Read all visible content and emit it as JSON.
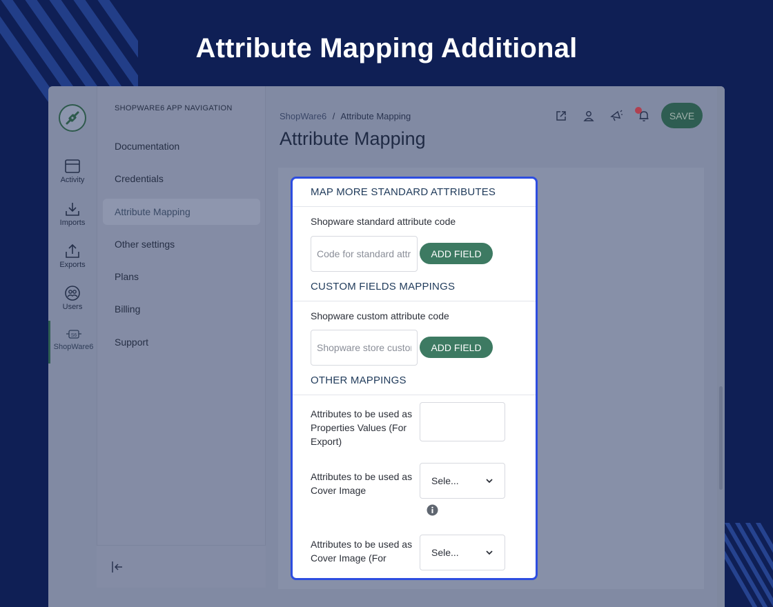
{
  "banner": {
    "title": "Attribute Mapping Additional"
  },
  "colors": {
    "background": "#0f1f55",
    "highlight_border": "#2d4de0",
    "accent_green": "#3d7a62"
  },
  "rail": {
    "logo_icon": "connector-plug-icon",
    "items": [
      {
        "label": "Activity",
        "icon": "calendar-window-icon"
      },
      {
        "label": "Imports",
        "icon": "download-tray-icon"
      },
      {
        "label": "Exports",
        "icon": "upload-tray-icon"
      },
      {
        "label": "Users",
        "icon": "users-circle-icon"
      },
      {
        "label": "ShopWare6",
        "icon": "shopware6-plug-icon",
        "active": true
      }
    ]
  },
  "nav": {
    "heading": "SHOPWARE6 APP NAVIGATION",
    "items": [
      {
        "label": "Documentation"
      },
      {
        "label": "Credentials"
      },
      {
        "label": "Attribute Mapping",
        "active": true
      },
      {
        "label": "Other settings"
      },
      {
        "label": "Plans"
      },
      {
        "label": "Billing"
      },
      {
        "label": "Support"
      }
    ],
    "collapse_icon": "collapse-left-icon"
  },
  "header": {
    "breadcrumb": [
      "ShopWare6",
      "Attribute Mapping"
    ],
    "breadcrumb_separator": "/",
    "title": "Attribute Mapping",
    "save_label": "SAVE"
  },
  "card": {
    "standard": {
      "title": "MAP MORE STANDARD ATTRIBUTES",
      "field_label": "Shopware standard attribute code",
      "placeholder": "Code for standard attribute",
      "button": "ADD FIELD"
    },
    "custom": {
      "title": "CUSTOM FIELDS MAPPINGS",
      "field_label": "Shopware custom attribute code",
      "placeholder": "Shopware store custom field",
      "button": "ADD FIELD"
    },
    "other": {
      "title": "OTHER MAPPINGS",
      "rows": [
        {
          "label": "Attributes to be used as Properties Values (For Export)",
          "value": ""
        },
        {
          "label": "Attributes to be used as Cover Image",
          "value": "Sele..."
        },
        {
          "label": "Attributes to be used as Cover Image (For",
          "value": "Sele..."
        }
      ]
    }
  }
}
